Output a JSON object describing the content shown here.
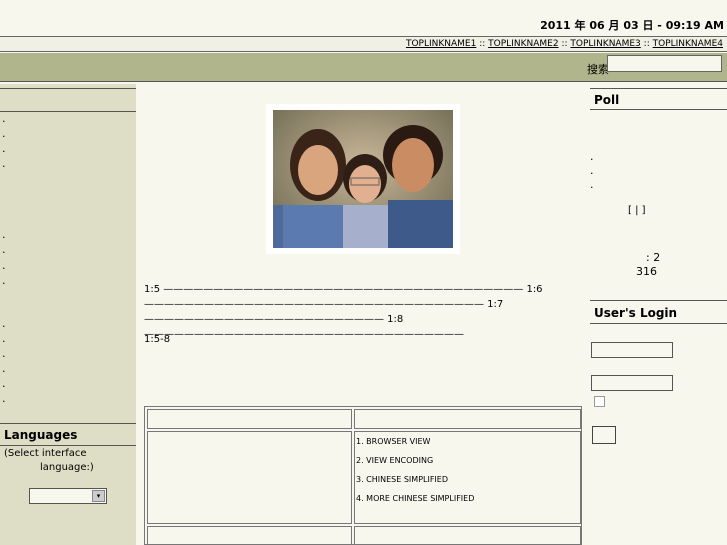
{
  "header": {
    "site_title": "",
    "date": "2011 年 06 月 03 日 - 09:19 AM"
  },
  "toplinks": [
    "TOPLINKNAME1",
    "TOPLINKNAME2",
    "TOPLINKNAME3",
    "TOPLINKNAME4"
  ],
  "toplinks_sep": "::",
  "search": {
    "label": "搜索",
    "value": ""
  },
  "left": {
    "block1_title": "",
    "block1_items": [
      "",
      "",
      "",
      ""
    ],
    "heading2": "",
    "heading3": "",
    "block3_items": [
      "",
      "",
      "",
      ""
    ],
    "heading4": "",
    "block4_items": [
      "",
      "",
      "",
      "",
      "",
      ""
    ],
    "languages_title": "Languages",
    "languages_prompt": "(Select interface",
    "languages_prompt2": "language:)",
    "languages_select": ""
  },
  "center": {
    "paragraph": "1:5 ———————————————————————————————————— 1:6 —————————————————————————————————— 1:7 ———————————————————————— 1:8 ————————————————————————————————",
    "reference": "1:5-8",
    "sub_heading": "",
    "table_header_left": "",
    "table_header_right": "",
    "table_left_1": "",
    "table_left_2": "",
    "steps": [
      "1. BROWSER VIEW",
      "2. VIEW ENCODING",
      "3. CHINESE SIMPLIFIED",
      "4. MORE CHINESE SIMPLIFIED",
      ""
    ]
  },
  "right": {
    "poll_title": "Poll",
    "poll_question": "",
    "poll_options": [
      "",
      "",
      ""
    ],
    "poll_vote": "",
    "poll_results": "",
    "stat1": "2",
    "stat2": "316",
    "login_title": "User's Login",
    "username_label": "",
    "password_label": "",
    "remember_label": "",
    "login_button": "",
    "login_note": ""
  }
}
